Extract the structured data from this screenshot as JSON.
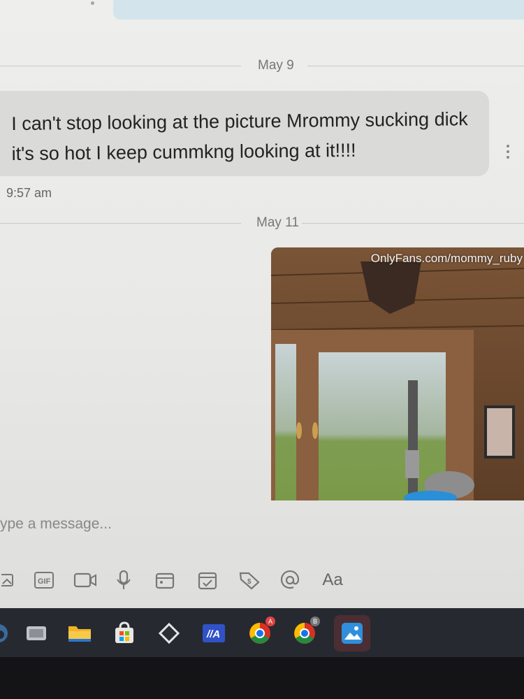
{
  "conversation": {
    "date_separators": [
      "May 9",
      "May 11"
    ],
    "message": {
      "text": "I can't stop looking at the picture Mrommy sucking dick it's so hot I keep cummkng looking at it!!!!",
      "time": "9:57 am"
    },
    "photo": {
      "watermark": "OnlyFans.com/mommy_ruby"
    }
  },
  "composer": {
    "placeholder": "ype a message...",
    "tools": [
      "image-icon",
      "gif-icon",
      "video-icon",
      "microphone-icon",
      "media-library-icon",
      "schedule-icon",
      "price-tag-icon",
      "mention-icon",
      "text-format-icon"
    ],
    "gif_label": "GIF",
    "format_label": "Aa"
  },
  "taskbar": {
    "icons": [
      "edge-icon",
      "task-view-icon",
      "file-explorer-icon",
      "store-icon",
      "app-icon",
      "app-icon-2",
      "chrome-icon",
      "chrome-icon-2",
      "photos-icon"
    ],
    "chrome_badges": [
      "A",
      "B"
    ]
  },
  "colors": {
    "bubble_received": "#dadad8",
    "bubble_sent": "#d4e4ec",
    "taskbar": "#262a30"
  }
}
